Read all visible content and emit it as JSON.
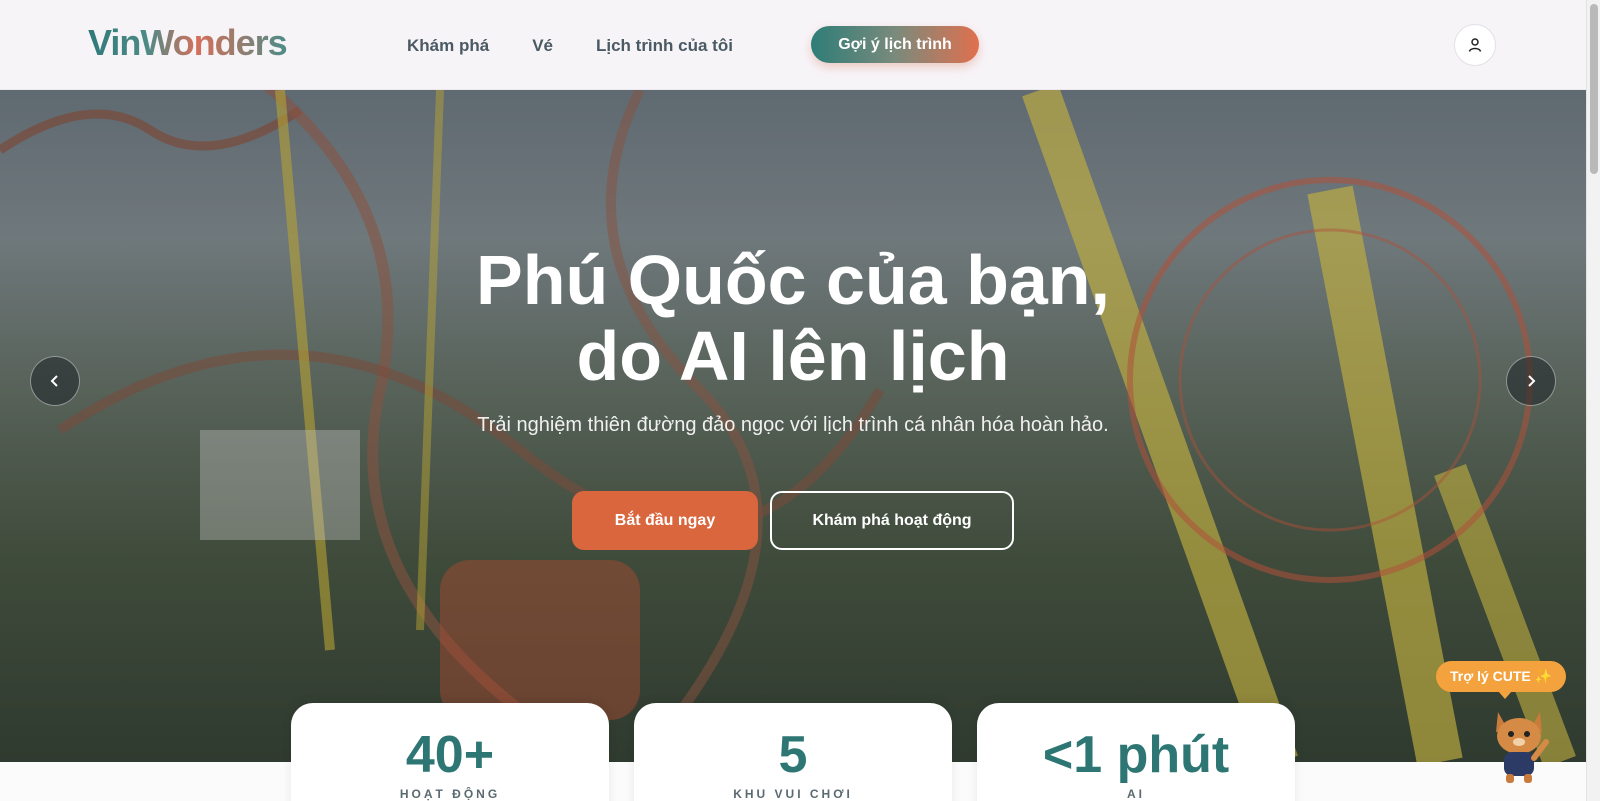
{
  "header": {
    "logo": "VinWonders",
    "nav": [
      "Khám phá",
      "Vé",
      "Lịch trình của tôi"
    ],
    "cta": "Gợi ý lịch trình",
    "user_icon": "user-icon"
  },
  "hero": {
    "title_line1": "Phú Quốc của bạn,",
    "title_line2": "do AI lên lịch",
    "subtitle": "Trải nghiệm thiên đường đảo ngọc với lịch trình cá nhân hóa hoàn hảo.",
    "primary_button": "Bắt đầu ngay",
    "secondary_button": "Khám phá hoạt động",
    "prev_icon": "chevron-left-icon",
    "next_icon": "chevron-right-icon"
  },
  "stats": [
    {
      "value": "40+",
      "label": "HOẠT ĐỘNG"
    },
    {
      "value": "5",
      "label": "KHU VUI CHƠI"
    },
    {
      "value": "<1 phút",
      "label": "AI"
    }
  ],
  "assistant": {
    "label": "Trợ lý CUTE ✨",
    "mascot_icon": "cat-mascot-icon"
  },
  "colors": {
    "brand_teal": "#2e7673",
    "brand_orange": "#d9663d",
    "badge_orange": "#f3a23e"
  }
}
